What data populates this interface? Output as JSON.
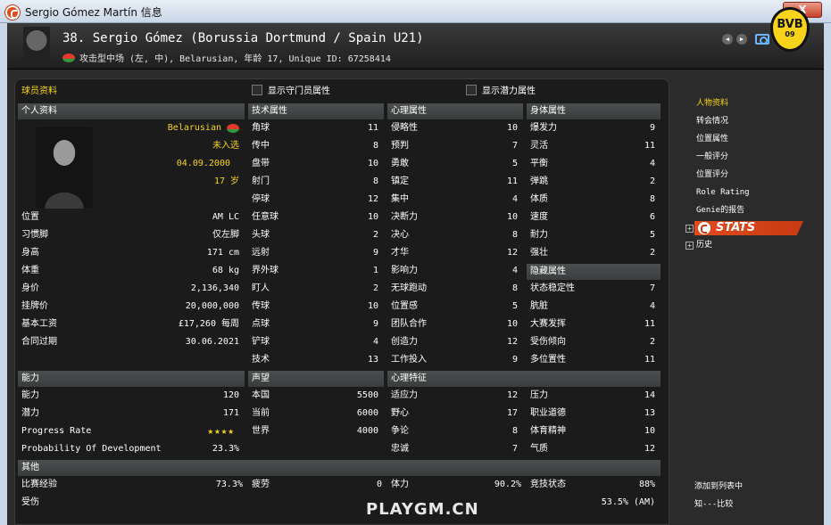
{
  "window": {
    "title": "Sergio Gómez Martín 信息",
    "close_label": "X"
  },
  "header": {
    "player_title": "38. Sergio Gómez (Borussia Dortmund / Spain U21)",
    "sub_line": "攻击型中场 (左, 中), Belarusian, 年龄 17, Unique ID: 67258414",
    "club_logo": {
      "text": "BVB",
      "year": "09"
    }
  },
  "panel": {
    "title": "球员资料",
    "checkbox_gk": "显示守门员属性",
    "checkbox_potential": "显示潜力属性"
  },
  "personal": {
    "heading": "个人资料",
    "nationality": "Belarusian",
    "selection": "未入选",
    "dob": "04.09.2000",
    "age": "17 岁",
    "rows": [
      {
        "label": "位置",
        "value": "AM LC"
      },
      {
        "label": "习惯脚",
        "value": "仅左脚"
      },
      {
        "label": "身高",
        "value": "171 cm"
      },
      {
        "label": "体重",
        "value": "68 kg"
      },
      {
        "label": "身价",
        "value": "2,136,340"
      },
      {
        "label": "挂牌价",
        "value": "20,000,000"
      },
      {
        "label": "基本工资",
        "value": "£17,260 每周"
      },
      {
        "label": "合同过期",
        "value": "30.06.2021"
      }
    ]
  },
  "technical": {
    "heading": "技术属性",
    "rows": [
      {
        "label": "角球",
        "value": "11",
        "color": "y"
      },
      {
        "label": "传中",
        "value": "8",
        "color": "w"
      },
      {
        "label": "盘带",
        "value": "10",
        "color": "w"
      },
      {
        "label": "射门",
        "value": "8",
        "color": "w"
      },
      {
        "label": "停球",
        "value": "12",
        "color": "y"
      },
      {
        "label": "任意球",
        "value": "10",
        "color": "w"
      },
      {
        "label": "头球",
        "value": "2",
        "color": "r"
      },
      {
        "label": "远射",
        "value": "9",
        "color": "w"
      },
      {
        "label": "界外球",
        "value": "1",
        "color": "r"
      },
      {
        "label": "盯人",
        "value": "2",
        "color": "r"
      },
      {
        "label": "传球",
        "value": "10",
        "color": "w"
      },
      {
        "label": "点球",
        "value": "9",
        "color": "w"
      },
      {
        "label": "铲球",
        "value": "4",
        "color": "gry"
      },
      {
        "label": "技术",
        "value": "13",
        "color": "y"
      }
    ]
  },
  "mental": {
    "heading": "心理属性",
    "rows": [
      {
        "label": "侵略性",
        "value": "10",
        "color": "w"
      },
      {
        "label": "预判",
        "value": "7",
        "color": "w"
      },
      {
        "label": "勇敢",
        "value": "5",
        "color": "gry"
      },
      {
        "label": "镇定",
        "value": "11",
        "color": "y"
      },
      {
        "label": "集中",
        "value": "4",
        "color": "r"
      },
      {
        "label": "决断力",
        "value": "10",
        "color": "w"
      },
      {
        "label": "决心",
        "value": "8",
        "color": "w"
      },
      {
        "label": "才华",
        "value": "12",
        "color": "y"
      },
      {
        "label": "影响力",
        "value": "4",
        "color": "r"
      },
      {
        "label": "无球跑动",
        "value": "8",
        "color": "w"
      },
      {
        "label": "位置感",
        "value": "5",
        "color": "gry"
      },
      {
        "label": "团队合作",
        "value": "10",
        "color": "w"
      },
      {
        "label": "创造力",
        "value": "12",
        "color": "y"
      },
      {
        "label": "工作投入",
        "value": "9",
        "color": "w"
      }
    ]
  },
  "physical": {
    "heading": "身体属性",
    "rows": [
      {
        "label": "爆发力",
        "value": "9",
        "color": "w"
      },
      {
        "label": "灵活",
        "value": "11",
        "color": "y"
      },
      {
        "label": "平衡",
        "value": "4",
        "color": "r"
      },
      {
        "label": "弹跳",
        "value": "2",
        "color": "r"
      },
      {
        "label": "体质",
        "value": "8",
        "color": "w"
      },
      {
        "label": "速度",
        "value": "6",
        "color": "w"
      },
      {
        "label": "耐力",
        "value": "5",
        "color": "gry"
      },
      {
        "label": "强壮",
        "value": "2",
        "color": "r"
      }
    ]
  },
  "hidden": {
    "heading": "隐藏属性",
    "rows": [
      {
        "label": "状态稳定性",
        "value": "7",
        "color": "w"
      },
      {
        "label": "肮脏",
        "value": "4",
        "color": "g"
      },
      {
        "label": "大赛发挥",
        "value": "11",
        "color": "y"
      },
      {
        "label": "受伤倾向",
        "value": "2",
        "color": "g"
      },
      {
        "label": "多位置性",
        "value": "11",
        "color": "y"
      }
    ]
  },
  "ability": {
    "heading": "能力",
    "rows": [
      {
        "label": "能力",
        "value": "120",
        "color": "y"
      },
      {
        "label": "潜力",
        "value": "171",
        "color": "g"
      }
    ],
    "progress_rate_label": "Progress Rate",
    "progress_rate_stars": 3.5,
    "prob_label": "Probability Of Development",
    "prob_value": "23.3%"
  },
  "reputation": {
    "heading": "声望",
    "rows": [
      {
        "label": "本国",
        "value": "5500",
        "color": "y"
      },
      {
        "label": "当前",
        "value": "6000",
        "color": "y"
      },
      {
        "label": "世界",
        "value": "4000",
        "color": "w"
      }
    ]
  },
  "traits": {
    "heading": "心理特征",
    "left": [
      {
        "label": "适应力",
        "value": "12",
        "color": "y"
      },
      {
        "label": "野心",
        "value": "17",
        "color": "g"
      },
      {
        "label": "争论",
        "value": "8",
        "color": "y"
      },
      {
        "label": "忠诚",
        "value": "7",
        "color": "w"
      }
    ],
    "right": [
      {
        "label": "压力",
        "value": "14",
        "color": "g"
      },
      {
        "label": "职业道德",
        "value": "13",
        "color": "y"
      },
      {
        "label": "体育精神",
        "value": "10",
        "color": "w"
      },
      {
        "label": "气质",
        "value": "12",
        "color": "y"
      }
    ]
  },
  "other": {
    "heading": "其他",
    "row1": [
      {
        "label": "比赛经验",
        "value": "73.3%",
        "color": "y"
      },
      {
        "label": "疲劳",
        "value": "0",
        "color": "y"
      },
      {
        "label": "体力",
        "value": "90.2%",
        "color": "g"
      },
      {
        "label": "竞技状态",
        "value": "88%",
        "color": "g"
      }
    ],
    "row2": [
      {
        "label": "受伤",
        "value": ""
      },
      {
        "label": "",
        "value": ""
      },
      {
        "label": "",
        "value": ""
      },
      {
        "label": "",
        "value": "53.5% (AM)",
        "color": "y"
      }
    ]
  },
  "side_nav": {
    "items": [
      "人物资料",
      "转会情况",
      "位置属性",
      "一般评分",
      "位置评分",
      "Role Rating",
      "Genie的报告"
    ],
    "active_index": 0,
    "stats_label": "STATS",
    "history_label": "历史",
    "bottom": [
      "添加到列表中",
      "知---比较"
    ]
  },
  "watermark": "PLAYGM.CN"
}
